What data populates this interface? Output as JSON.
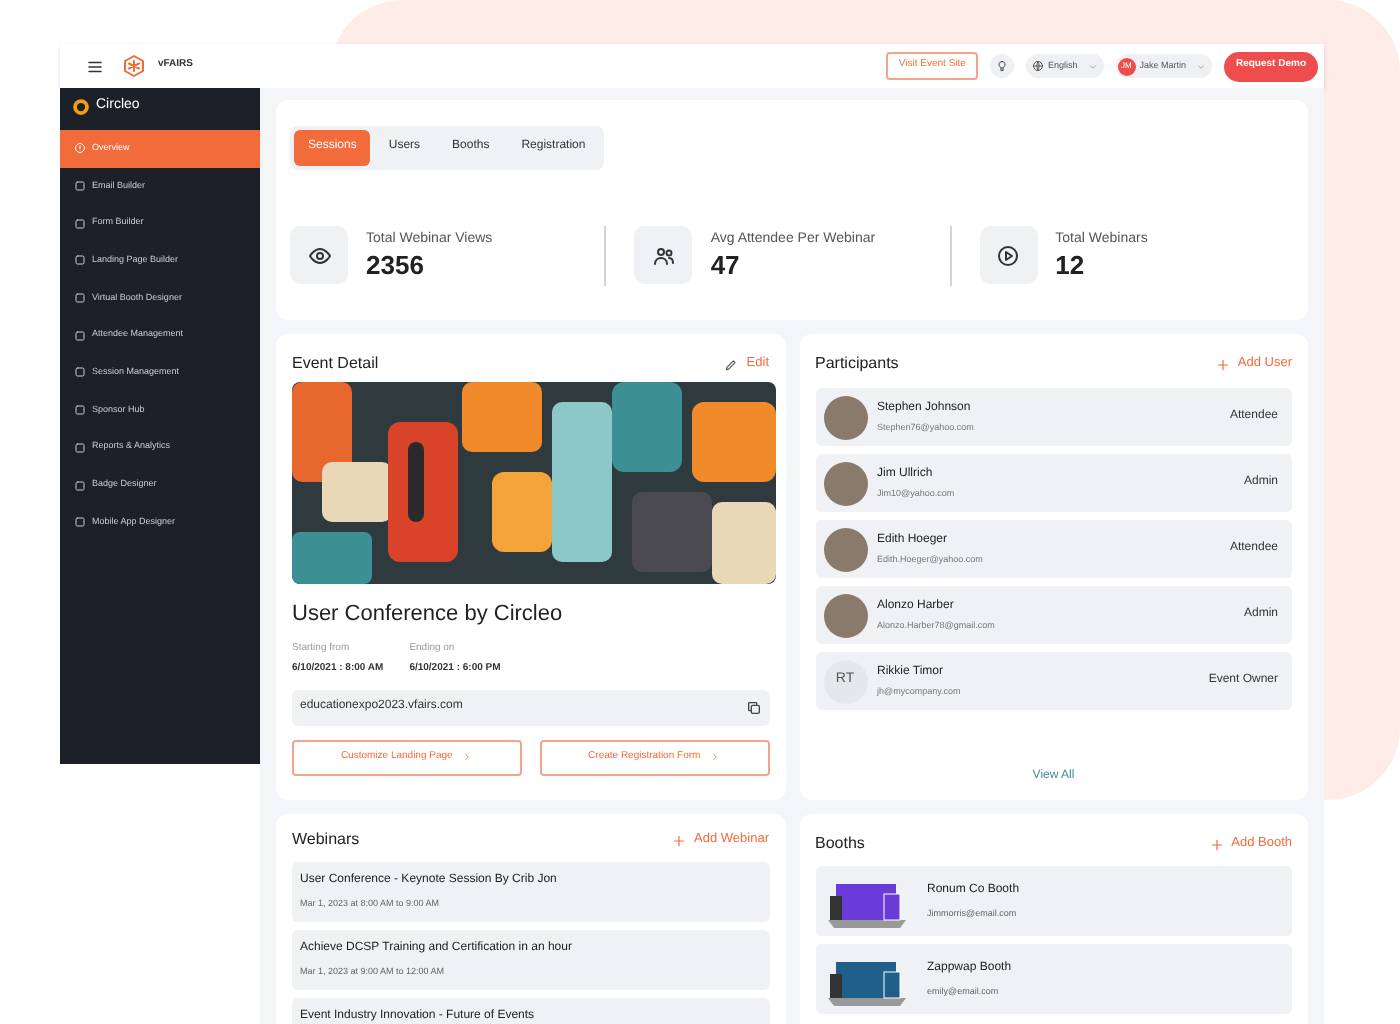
{
  "topbar": {
    "logo": "vFAIRS",
    "visit_button": "Visit Event Site",
    "language": "English",
    "user": {
      "initials": "JM",
      "name": "Jake Martin"
    },
    "demo_button": "Request Demo"
  },
  "sidebar": {
    "brand": "Circleo",
    "items": [
      {
        "label": "Overview",
        "selected": true
      },
      {
        "label": "Email Builder",
        "selected": false
      },
      {
        "label": "Form Builder",
        "selected": false
      },
      {
        "label": "Landing Page Builder",
        "selected": false
      },
      {
        "label": "Virtual Booth Designer",
        "selected": false
      },
      {
        "label": "Attendee Management",
        "selected": false
      },
      {
        "label": "Session Management",
        "selected": false
      },
      {
        "label": "Sponsor Hub",
        "selected": false
      },
      {
        "label": "Reports & Analytics",
        "selected": false
      },
      {
        "label": "Badge Designer",
        "selected": false
      },
      {
        "label": "Mobile App Designer",
        "selected": false
      }
    ]
  },
  "tabs": [
    {
      "label": "Sessions",
      "selected": true
    },
    {
      "label": "Users",
      "selected": false
    },
    {
      "label": "Booths",
      "selected": false
    },
    {
      "label": "Registration",
      "selected": false
    }
  ],
  "stats": [
    {
      "kind": "views",
      "label": "Total Webinar Views",
      "value": "2356"
    },
    {
      "kind": "attendees",
      "label": "Avg Attendee Per Webinar",
      "value": "47"
    },
    {
      "kind": "webinars",
      "label": "Total Webinars",
      "value": "12"
    }
  ],
  "event_detail": {
    "title": "Event Detail",
    "edit": "Edit",
    "name": "User Conference by Circleo",
    "start_label": "Starting from",
    "start": "6/10/2021 : 8:00 AM",
    "end_label": "Ending on",
    "end": "6/10/2021 : 6:00 PM",
    "url": "educationexpo2023.vfairs.com",
    "buttons": [
      "Customize Landing Page",
      "Create Registration Form"
    ]
  },
  "participants": {
    "title": "Participants",
    "add": "Add User",
    "rows": [
      {
        "kind": "photo",
        "name": "Stephen Johnson",
        "email": "Stephen76@yahoo.com",
        "role": "Attendee"
      },
      {
        "kind": "photo",
        "name": "Jim Ullrich",
        "email": "Jim10@yahoo.com",
        "role": "Admin"
      },
      {
        "kind": "photo",
        "name": "Edith Hoeger",
        "email": "Edith.Hoeger@yahoo.com",
        "role": "Attendee"
      },
      {
        "kind": "photo",
        "name": "Alonzo Harber",
        "email": "Alonzo.Harber78@gmail.com",
        "role": "Admin"
      },
      {
        "kind": "initials",
        "initials": "RT",
        "name": "Rikkie Timor",
        "email": "jh@mycompany.com",
        "role": "Event Owner"
      }
    ],
    "view_all": "View All"
  },
  "webinars": {
    "title": "Webinars",
    "add": "Add Webinar",
    "items": [
      {
        "title": "User Conference - Keynote Session By Crib Jon",
        "time": "Mar 1, 2023 at 8:00 AM to 9:00 AM"
      },
      {
        "title": "Achieve DCSP Training and Certification in an hour",
        "time": "Mar 1, 2023 at 9:00 AM to 12:00 AM"
      },
      {
        "title": "Event Industry Innovation - Future of Events"
      }
    ]
  },
  "booths": {
    "title": "Booths",
    "add": "Add Booth",
    "items": [
      {
        "kind": "purple",
        "name": "Ronum Co Booth",
        "email": "Jimmorris@email.com"
      },
      {
        "kind": "blue",
        "name": "Zappwap Booth",
        "email": "emily@email.com"
      }
    ]
  }
}
